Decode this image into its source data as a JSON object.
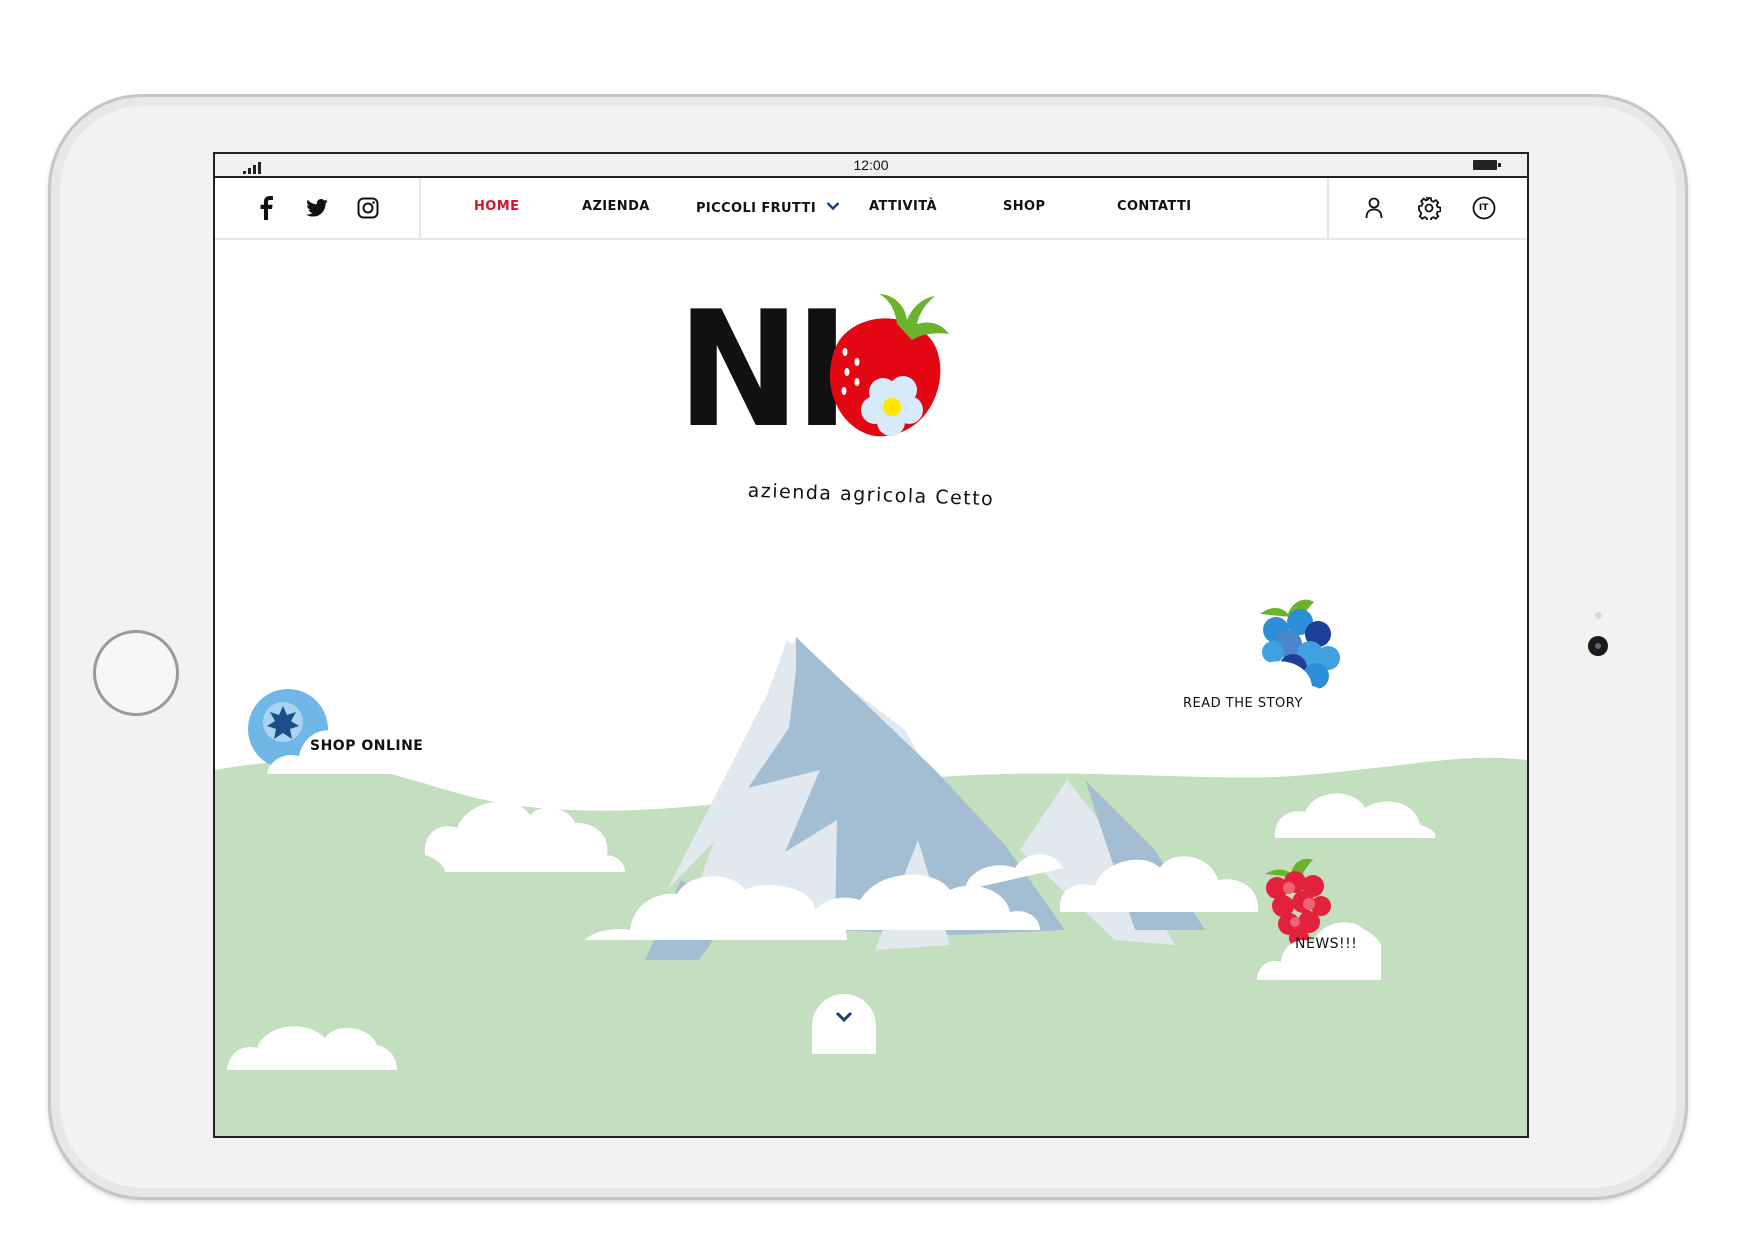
{
  "statusbar": {
    "time": "12:00"
  },
  "social": [
    "facebook-icon",
    "twitter-icon",
    "instagram-icon"
  ],
  "nav": {
    "items": [
      "HOME",
      "AZIENDA",
      "PICCOLI FRUTTI",
      "ATTIVITÀ",
      "SHOP",
      "CONTATTI"
    ],
    "active": "HOME",
    "active_color": "#d5122b"
  },
  "tools": {
    "language": "IT",
    "icons": [
      "user-icon",
      "gear-icon",
      "language-icon"
    ]
  },
  "hero": {
    "logo_text": "NI",
    "tagline": "azienda agricola Cetto",
    "links": {
      "shop": "SHOP ONLINE",
      "story": "READ THE STORY",
      "news": "NEWS!!!"
    }
  },
  "colors": {
    "meadow": "#c4dfc0",
    "mountain_light": "#e1e9ef",
    "mountain_dark": "#a3bed3",
    "strawberry": "#e30613",
    "leaf": "#6ab42d",
    "blueberry": "#6fb7e6"
  }
}
